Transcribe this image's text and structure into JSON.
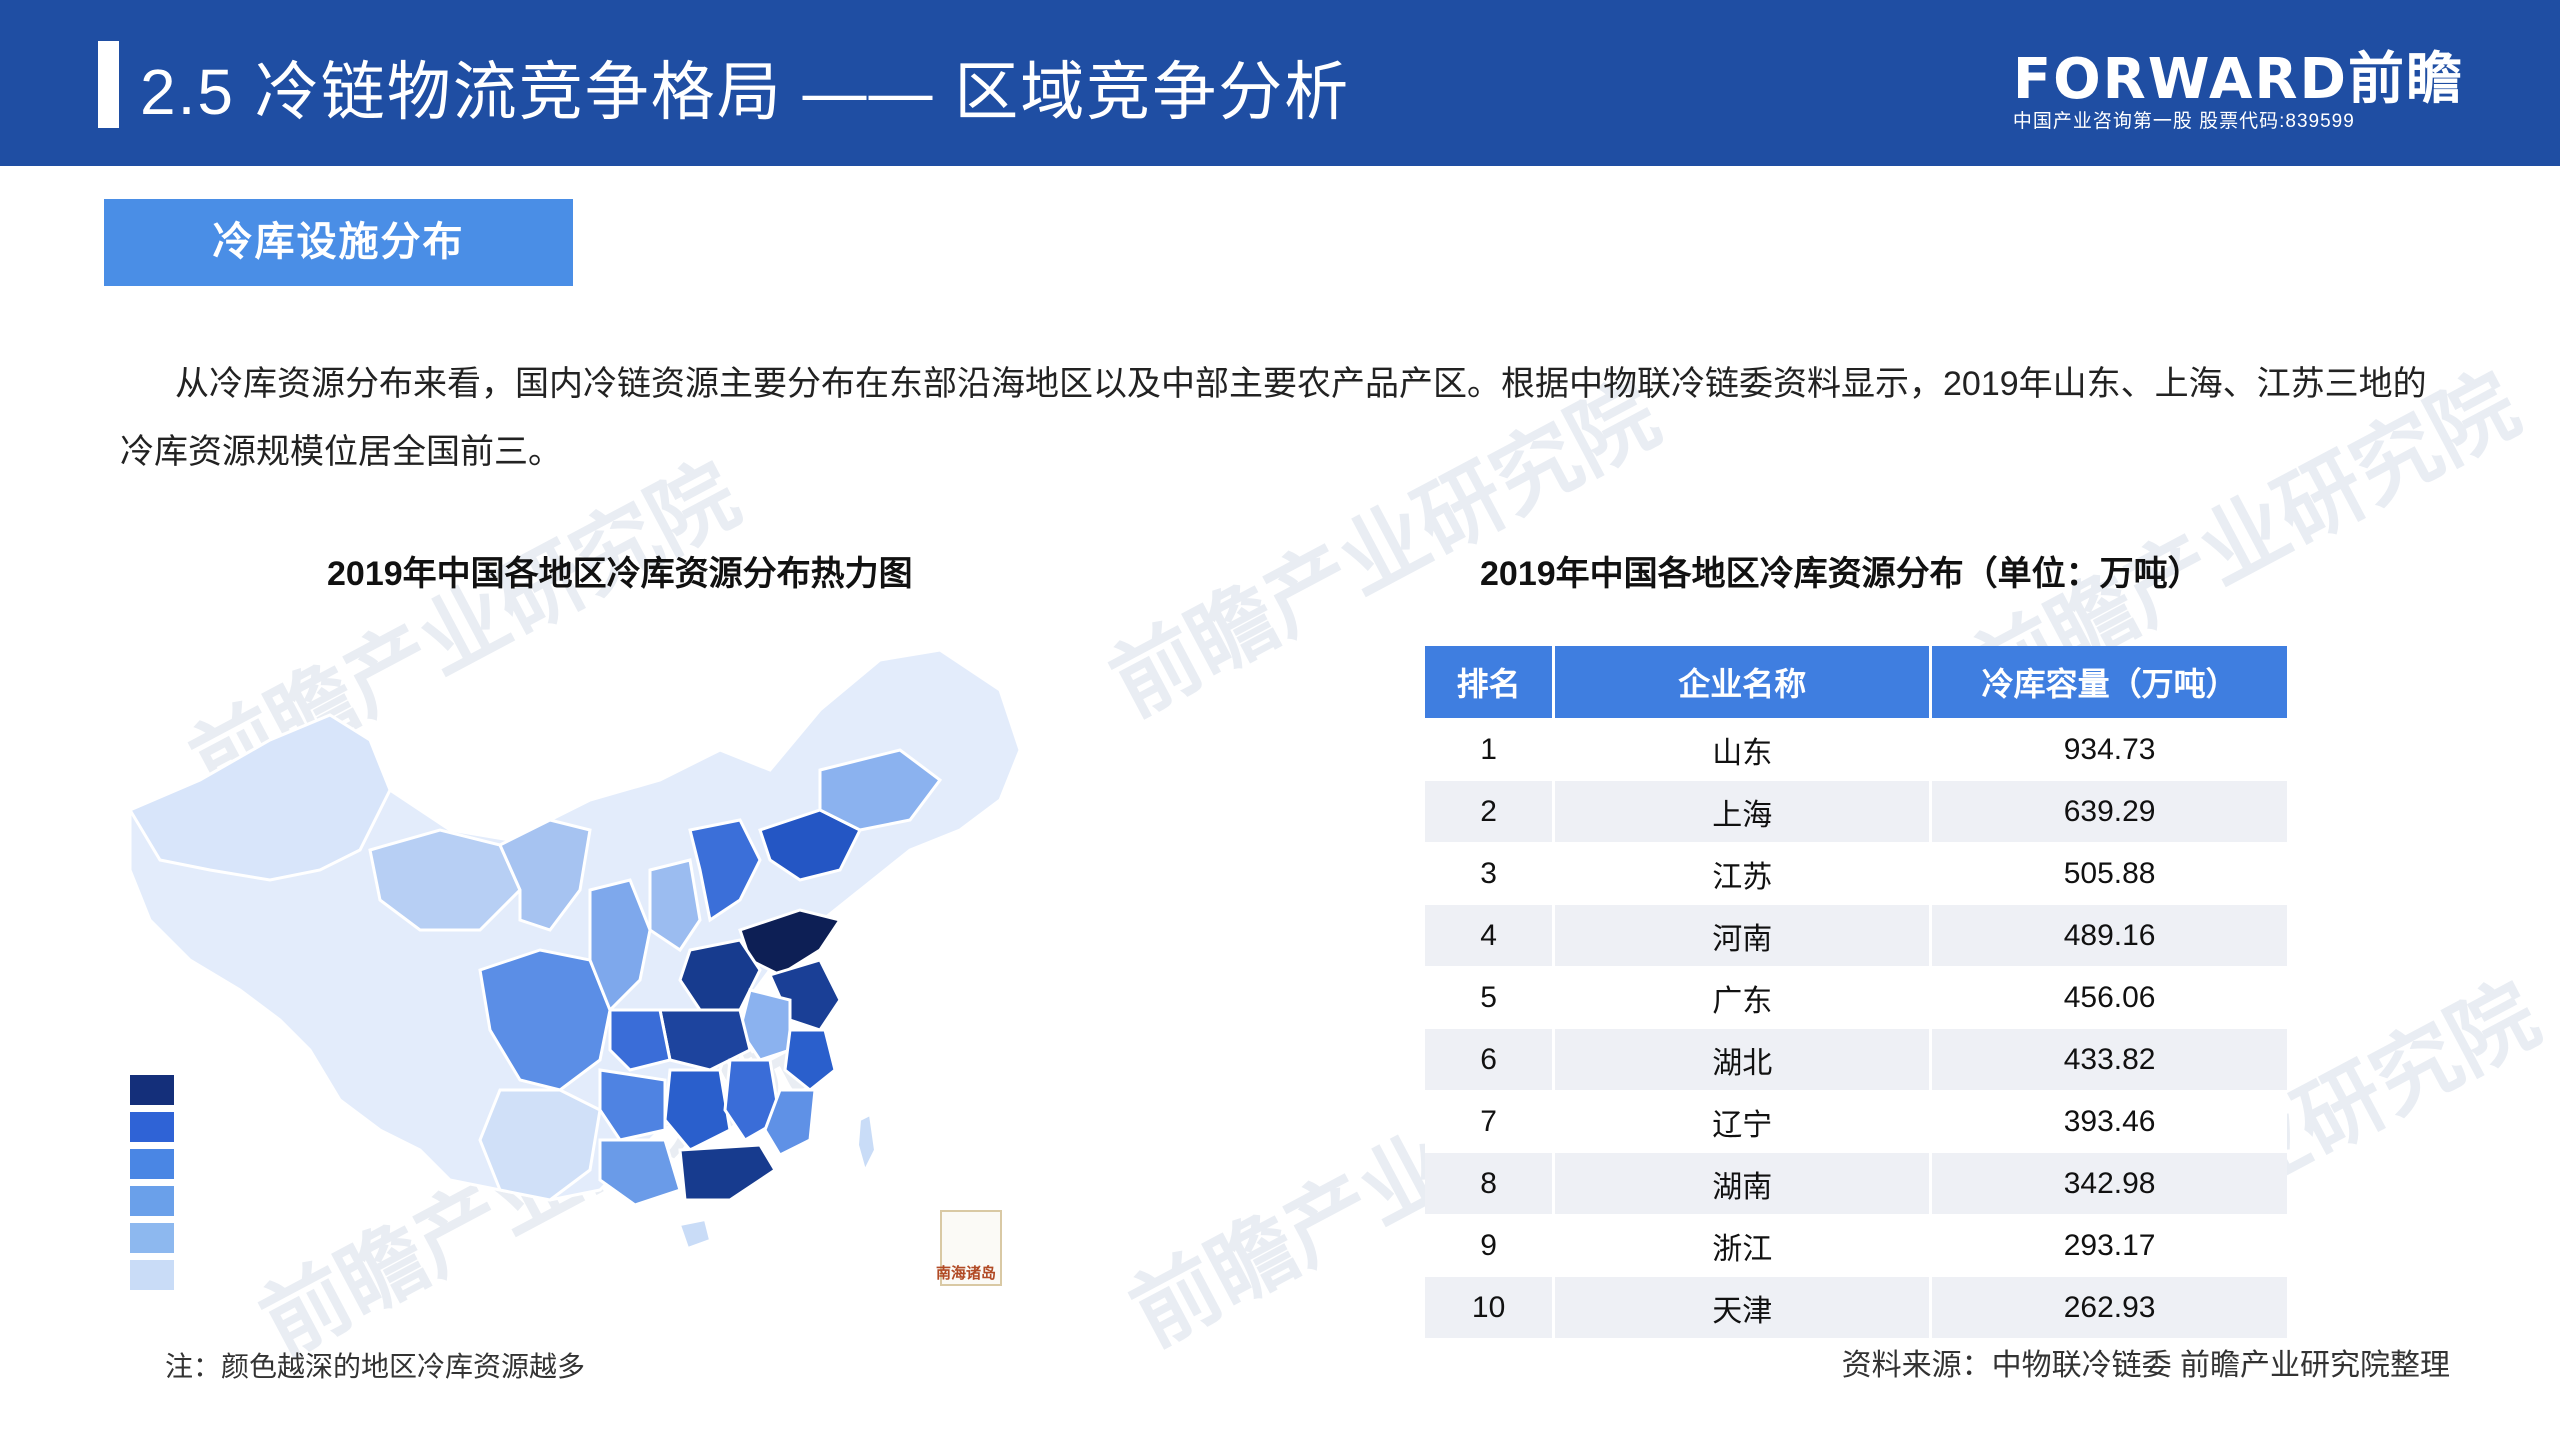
{
  "header": {
    "title": "2.5 冷链物流竞争格局 —— 区域竞争分析",
    "brand_logo": "FORWARD前瞻",
    "brand_tagline": "中国产业咨询第一股 股票代码:839599"
  },
  "section": {
    "label": "冷库设施分布"
  },
  "intro_text": "从冷库资源分布来看，国内冷链资源主要分布在东部沿海地区以及中部主要农产品产区。根据中物联冷链委资料显示，2019年山东、上海、江苏三地的冷库资源规模位居全国前三。",
  "watermark": {
    "text": "前瞻产业研究院"
  },
  "map": {
    "title": "2019年中国各地区冷库资源分布热力图",
    "nanhai_label": "南海诸岛",
    "legend_colors": [
      "#142f7a",
      "#2f63d6",
      "#4a86e4",
      "#6aa0ea",
      "#8db8ef",
      "#c9dcf7"
    ],
    "note": "注：颜色越深的地区冷库资源越多"
  },
  "table": {
    "title": "2019年中国各地区冷库资源分布（单位：万吨）",
    "headers": [
      "排名",
      "企业名称",
      "冷库容量（万吨）"
    ],
    "rows": [
      [
        "1",
        "山东",
        "934.73"
      ],
      [
        "2",
        "上海",
        "639.29"
      ],
      [
        "3",
        "江苏",
        "505.88"
      ],
      [
        "4",
        "河南",
        "489.16"
      ],
      [
        "5",
        "广东",
        "456.06"
      ],
      [
        "6",
        "湖北",
        "433.82"
      ],
      [
        "7",
        "辽宁",
        "393.46"
      ],
      [
        "8",
        "湖南",
        "342.98"
      ],
      [
        "9",
        "浙江",
        "293.17"
      ],
      [
        "10",
        "天津",
        "262.93"
      ]
    ]
  },
  "source": "资料来源：中物联冷链委 前瞻产业研究院整理"
}
